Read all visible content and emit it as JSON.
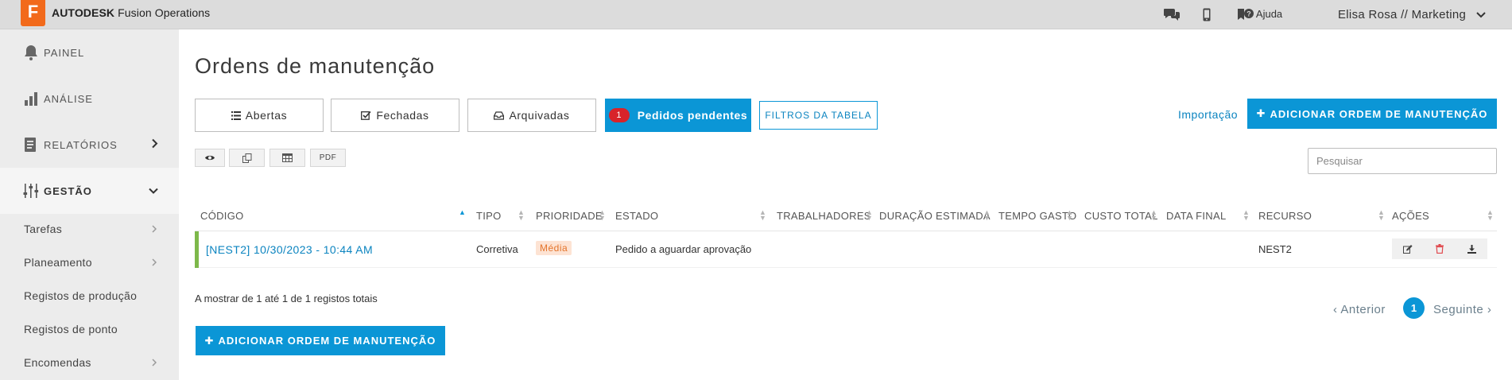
{
  "app": {
    "logo_letter": "F",
    "brand_bold": "AUTODESK",
    "brand_rest": " Fusion Operations",
    "help_label": "Ajuda",
    "user_label": "Elisa Rosa // Marketing"
  },
  "sidebar": {
    "items": [
      {
        "label": "PAINEL",
        "icon": "bell-icon"
      },
      {
        "label": "ANÁLISE",
        "icon": "bar-chart-icon"
      },
      {
        "label": "RELATÓRIOS",
        "icon": "report-icon"
      },
      {
        "label": "GESTÃO",
        "icon": "sliders-icon"
      }
    ],
    "sub_items": [
      {
        "label": "Tarefas"
      },
      {
        "label": "Planeamento"
      },
      {
        "label": "Registos de produção"
      },
      {
        "label": "Registos de ponto"
      },
      {
        "label": "Encomendas"
      }
    ]
  },
  "page": {
    "title": "Ordens de manutenção"
  },
  "tabs": {
    "open": "Abertas",
    "closed": "Fechadas",
    "archived": "Arquivadas",
    "pending": "Pedidos pendentes",
    "pending_count": "1"
  },
  "toolbar": {
    "filters": "FILTROS DA TABELA",
    "import": "Importação",
    "add": "ADICIONAR ORDEM DE MANUTENÇÃO",
    "pdf": "PDF",
    "search_placeholder": "Pesquisar"
  },
  "table": {
    "headers": [
      "CÓDIGO",
      "TIPO",
      "PRIORIDADE",
      "ESTADO",
      "TRABALHADORES",
      "DURAÇÃO ESTIMADA",
      "TEMPO GASTO",
      "CUSTO TOTAL",
      "DATA FINAL",
      "RECURSO",
      "AÇÕES"
    ],
    "rows": [
      {
        "code": "[NEST2] 10/30/2023 - 10:44 AM",
        "type": "Corretiva",
        "priority": "Média",
        "status": "Pedido a aguardar aprovação",
        "resource": "NEST2"
      }
    ]
  },
  "footer": {
    "summary": "A mostrar de 1 até 1 de 1 registos totais",
    "prev": "Anterior",
    "page": "1",
    "next": "Seguinte",
    "add": "ADICIONAR ORDEM DE MANUTENÇÃO"
  },
  "colors": {
    "accent": "#0b96d6",
    "brand_orange": "#f26a1b",
    "row_status": "#7db84a",
    "badge_red": "#d8232a"
  }
}
